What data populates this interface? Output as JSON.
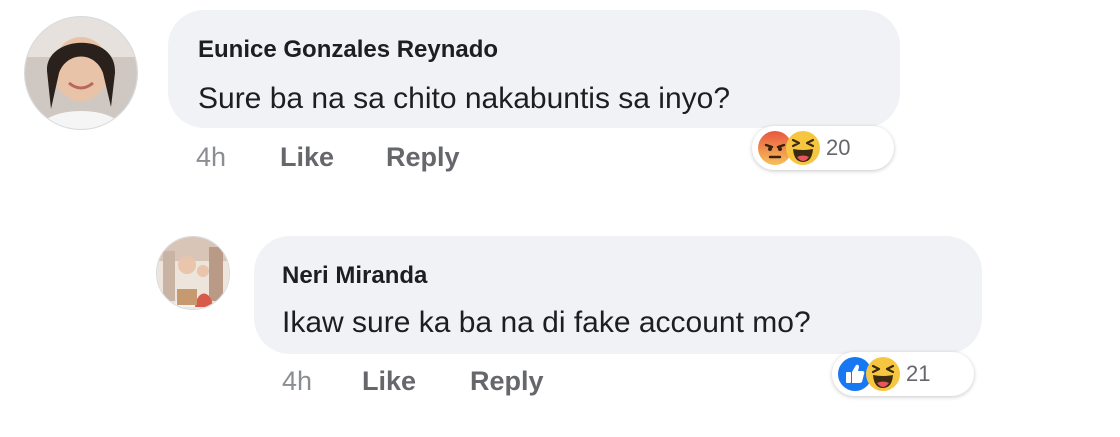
{
  "comments": [
    {
      "author": "Eunice Gonzales Reynado",
      "text": "Sure ba na sa chito nakabuntis sa inyo?",
      "time": "4h",
      "like_label": "Like",
      "reply_label": "Reply",
      "reactions": {
        "icons": [
          "angry-icon",
          "haha-icon"
        ],
        "count": "20"
      }
    },
    {
      "author": "Neri Miranda",
      "text": "Ikaw sure ka ba na di fake account mo?",
      "time": "4h",
      "like_label": "Like",
      "reply_label": "Reply",
      "reactions": {
        "icons": [
          "like-icon",
          "haha-icon"
        ],
        "count": "21"
      }
    }
  ],
  "colors": {
    "bubble_bg": "#f0f2f5",
    "meta_text": "#65676b",
    "like_blue": "#1877f2",
    "angry_red": "#e9573f",
    "haha_yellow": "#f7c640"
  }
}
